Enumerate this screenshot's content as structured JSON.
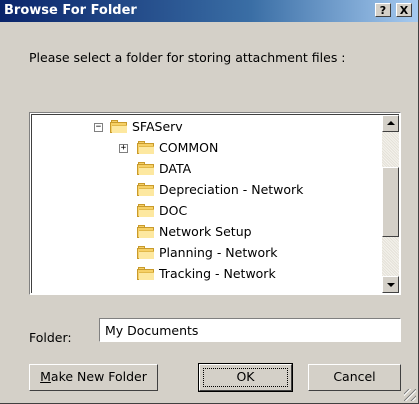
{
  "window": {
    "title": "Browse For Folder",
    "help_label": "?",
    "close_label": "X"
  },
  "prompt": "Please select a folder for storing attachment files :",
  "tree": {
    "root": {
      "label": "SFAServ",
      "expander": "−"
    },
    "children": [
      {
        "label": "COMMON",
        "expander": "+"
      },
      {
        "label": "DATA"
      },
      {
        "label": "Depreciation - Network"
      },
      {
        "label": "DOC"
      },
      {
        "label": "Network Setup"
      },
      {
        "label": "Planning - Network"
      },
      {
        "label": "Tracking - Network"
      }
    ]
  },
  "folder_field": {
    "label": "Folder:",
    "value": "My Documents"
  },
  "buttons": {
    "make_new_folder": {
      "mnemonic": "M",
      "rest": "ake New Folder"
    },
    "ok": "OK",
    "cancel": "Cancel"
  }
}
